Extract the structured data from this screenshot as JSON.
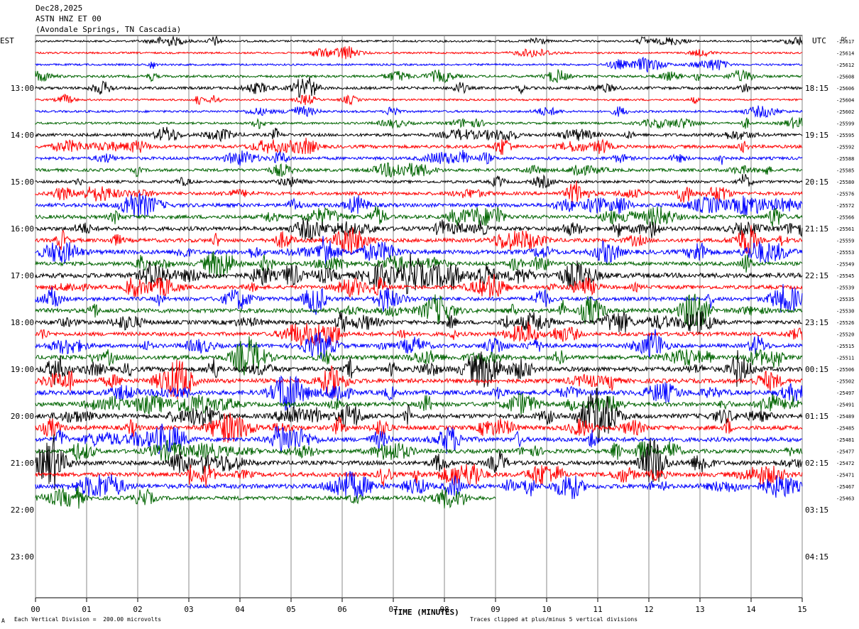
{
  "header": {
    "date": "Dec28,2025",
    "station": "ASTN HNZ ET 00",
    "location": "(Avondale Springs, TN Cascadia)"
  },
  "left_tz": "EST",
  "right_tz": "UTC",
  "dc_label": "DC",
  "footer": {
    "scale_note": "Each Vertical Division =  200.00 microvolts",
    "clip_note": "Traces clipped at plus/minus 5 vertical divisions",
    "corner_mark": "A"
  },
  "chart_data": {
    "type": "line",
    "title": "ASTN HNZ ET 00",
    "xlabel": "TIME (MINUTES)",
    "x_ticks": [
      "00",
      "01",
      "02",
      "03",
      "04",
      "05",
      "06",
      "07",
      "08",
      "09",
      "10",
      "11",
      "12",
      "13",
      "14",
      "15"
    ],
    "xlim": [
      0,
      15
    ],
    "est_hour_labels": [
      "13:00",
      "14:00",
      "15:00",
      "16:00",
      "17:00",
      "18:00",
      "19:00",
      "20:00",
      "21:00",
      "22:00",
      "23:00"
    ],
    "utc_hour_labels": [
      "18:15",
      "19:15",
      "20:15",
      "21:15",
      "22:15",
      "23:15",
      "00:15",
      "01:15",
      "02:15",
      "03:15",
      "04:15"
    ],
    "trace_colors": [
      "#000000",
      "#ff0000",
      "#0000ff",
      "#006400"
    ],
    "grid": true,
    "trace_dc_offsets": [
      "-25617",
      "-25614",
      "-25612",
      "-25608",
      "-25606",
      "-25604",
      "-25602",
      "-25599",
      "-25595",
      "-25592",
      "-25588",
      "-25585",
      "-25580",
      "-25576",
      "-25572",
      "-25566",
      "-25561",
      "-25559",
      "-25553",
      "-25549",
      "-25545",
      "-25539",
      "-25535",
      "-25530",
      "-25526",
      "-25520",
      "-25515",
      "-25511",
      "-25506",
      "-25502",
      "-25497",
      "-25491",
      "-25489",
      "-25485",
      "-25481",
      "-25477",
      "-25472",
      "-25471",
      "-25467",
      "-25463"
    ],
    "trace_activity": [
      0.3,
      0.25,
      0.3,
      0.5,
      0.6,
      0.3,
      0.4,
      0.4,
      0.7,
      0.8,
      0.7,
      0.7,
      0.6,
      0.8,
      1.0,
      1.0,
      1.1,
      1.0,
      1.2,
      1.0,
      1.4,
      1.0,
      1.0,
      1.2,
      1.1,
      1.0,
      1.0,
      1.2,
      1.3,
      1.2,
      1.3,
      1.2,
      1.3,
      1.2,
      1.2,
      1.1,
      1.2,
      1.2,
      1.3,
      1.0
    ],
    "last_trace_end_minute": 9.0
  }
}
